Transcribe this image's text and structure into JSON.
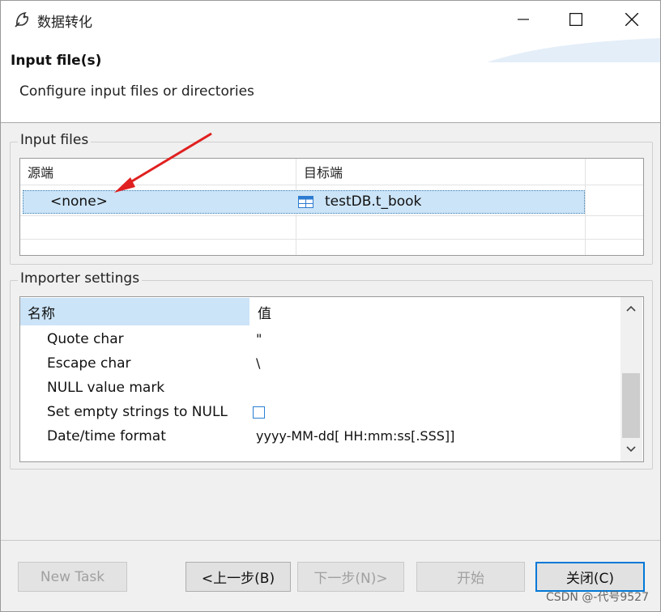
{
  "window": {
    "title": "数据转化",
    "controls": {
      "minimize": "minimize-icon",
      "maximize": "maximize-icon",
      "close": "close-icon"
    }
  },
  "header": {
    "title": "Input file(s)",
    "description": "Configure input files or directories"
  },
  "input_files": {
    "group_label": "Input files",
    "columns": [
      "源端",
      "目标端"
    ],
    "rows": [
      {
        "source": "<none>",
        "target": "testDB.t_book",
        "target_icon": "table-icon",
        "selected": true
      }
    ]
  },
  "importer_settings": {
    "group_label": "Importer settings",
    "columns": [
      "名称",
      "值"
    ],
    "properties": [
      {
        "name": "Quote char",
        "value": "\""
      },
      {
        "name": "Escape char",
        "value": "\\"
      },
      {
        "name": "NULL value mark",
        "value": ""
      },
      {
        "name": "Set empty strings to NULL",
        "value": "",
        "checkbox": true,
        "checked": false
      },
      {
        "name": "Date/time format",
        "value": "yyyy-MM-dd[ HH:mm:ss[.SSS]]"
      }
    ]
  },
  "buttons": {
    "new_task": "New Task",
    "back": "<上一步(B)",
    "next": "下一步(N)>",
    "start": "开始",
    "close": "关闭(C)"
  },
  "watermark": "CSDN @-代号9527",
  "colors": {
    "selection": "#cce4f7",
    "accent": "#0078d7",
    "arrow": "#e02020"
  }
}
